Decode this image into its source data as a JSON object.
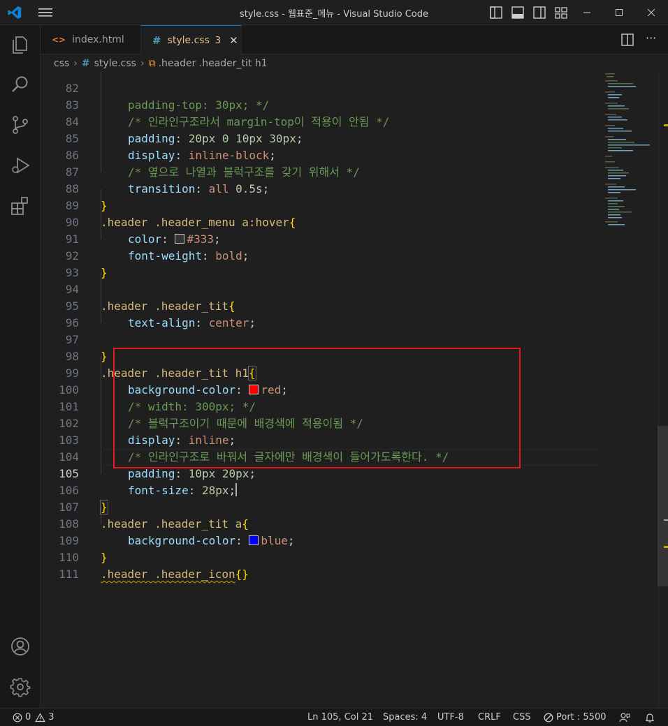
{
  "window": {
    "title": "style.css - 웹표준_메뉴 - Visual Studio Code"
  },
  "tabs": [
    {
      "label": "index.html",
      "icon": "html-file-icon",
      "active": false
    },
    {
      "label": "style.css",
      "icon": "css-file-icon",
      "active": true,
      "problems": "3"
    }
  ],
  "breadcrumb": {
    "folder": "css",
    "file": "style.css",
    "symbol": ".header .header_tit h1"
  },
  "editor": {
    "first_line_partial": "padding-top: 30px; */",
    "current_line": "105",
    "lines": [
      {
        "n": "82"
      },
      {
        "n": "83"
      },
      {
        "n": "84"
      },
      {
        "n": "85"
      },
      {
        "n": "86"
      },
      {
        "n": "87"
      },
      {
        "n": "88"
      },
      {
        "n": "89"
      },
      {
        "n": "90"
      },
      {
        "n": "91"
      },
      {
        "n": "92"
      },
      {
        "n": "93"
      },
      {
        "n": "94"
      },
      {
        "n": "95"
      },
      {
        "n": "96"
      },
      {
        "n": "97"
      },
      {
        "n": "98"
      },
      {
        "n": "99"
      },
      {
        "n": "100"
      },
      {
        "n": "101"
      },
      {
        "n": "102"
      },
      {
        "n": "103"
      },
      {
        "n": "104"
      },
      {
        "n": "105"
      },
      {
        "n": "106"
      },
      {
        "n": "107"
      },
      {
        "n": "108"
      },
      {
        "n": "109"
      },
      {
        "n": "110"
      },
      {
        "n": "111"
      }
    ],
    "code": {
      "l83": "/* 인라인구조라서 margin-top이 적용이 안됨 */",
      "l84_prop": "padding",
      "l84_val": "20px 0 10px 30px",
      "l85_prop": "display",
      "l85_val": "inline-block",
      "l86": "/* 옆으로 나열과 블럭구조를 갖기 위해서 */",
      "l87_prop": "transition",
      "l87_val1": "all",
      "l87_val2": "0.5s",
      "l89_sel": ".header .header_menu a:hover",
      "l90_prop": "color",
      "l90_val": "#333",
      "l91_prop": "font-weight",
      "l91_val": "bold",
      "l94_sel": ".header .header_tit",
      "l95_prop": "text-align",
      "l95_val": "center",
      "l98_sel": ".header .header_tit h1",
      "l99_prop": "background-color",
      "l99_val": "red",
      "l100": "/* width: 300px; */",
      "l101": "/* 블럭구조이기 때문에 배경색에 적용이됨 */",
      "l102_prop": "display",
      "l102_val": "inline",
      "l103": "/* 인라인구조로 바꿔서 글자에만 배경색이 들어가도록한다. */",
      "l104_prop": "padding",
      "l104_val": "10px 20px",
      "l105_prop": "font-size",
      "l105_val": "28px",
      "l107_sel": ".header .header_tit a",
      "l108_prop": "background-color",
      "l108_val": "blue",
      "l110_sel": ".header .header_icon"
    },
    "swatches": {
      "dark": "#333333",
      "red": "#ff0000",
      "blue": "#0000ff"
    }
  },
  "statusbar": {
    "errors": "0",
    "warnings": "3",
    "position": "Ln 105, Col 21",
    "spaces": "Spaces: 4",
    "encoding": "UTF-8",
    "eol": "CRLF",
    "language": "CSS",
    "port": "Port : 5500"
  },
  "colors": {
    "accent": "#0078d4",
    "highlight_box": "#e51b1b",
    "tab_modified": "#e2c08d"
  }
}
